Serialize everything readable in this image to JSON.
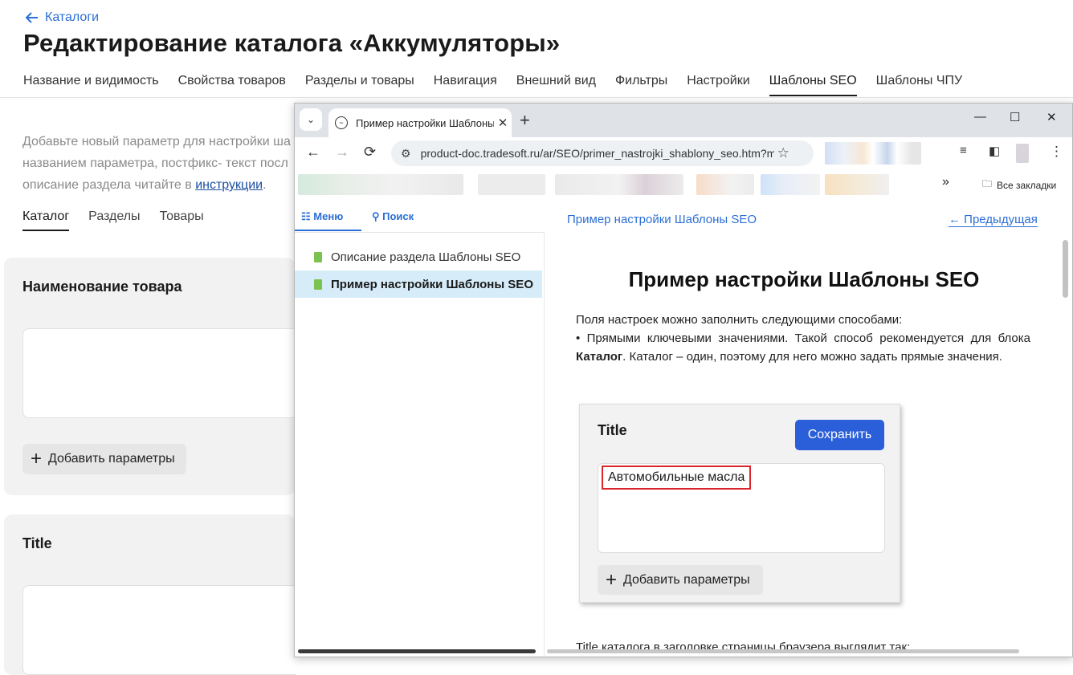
{
  "app": {
    "back_link": "Каталоги",
    "page_title": "Редактирование каталога «Аккумуляторы»",
    "tabs": [
      {
        "label": "Название и видимость",
        "active": false
      },
      {
        "label": "Свойства товаров",
        "active": false
      },
      {
        "label": "Разделы и товары",
        "active": false
      },
      {
        "label": "Навигация",
        "active": false
      },
      {
        "label": "Внешний вид",
        "active": false
      },
      {
        "label": "Фильтры",
        "active": false
      },
      {
        "label": "Настройки",
        "active": false
      },
      {
        "label": "Шаблоны SEO",
        "active": true
      },
      {
        "label": "Шаблоны ЧПУ",
        "active": false
      }
    ],
    "description": {
      "line1": "Добавьте новый параметр для настройки ша",
      "line2": "названием параметра, постфикс- текст посл",
      "line3_prefix": "описание раздела читайте в ",
      "line3_link": "инструкции",
      "line3_suffix": "."
    },
    "subtabs": [
      {
        "label": "Каталог",
        "active": true
      },
      {
        "label": "Разделы",
        "active": false
      },
      {
        "label": "Товары",
        "active": false
      }
    ],
    "card1": {
      "title": "Наименование товара",
      "add_button": "Добавить параметры"
    },
    "card2": {
      "title": "Title"
    }
  },
  "browser": {
    "tab_title": "Пример настройки Шаблоны SEO",
    "url": "product-doc.tradesoft.ru/ar/SEO/primer_nastrojki_shablony_seo.htm?m...",
    "bookmarks_folder": "Все закладки",
    "doc": {
      "sidebar_tabs": {
        "menu": "Меню",
        "search": "Поиск"
      },
      "sidebar_items": [
        {
          "label": "Описание раздела Шаблоны SEO",
          "active": false
        },
        {
          "label": "Пример настройки Шаблоны SEO",
          "active": true
        }
      ],
      "breadcrumb": "Пример настройки Шаблоны SEO",
      "prev_link": "← Предыдущая",
      "heading": "Пример настройки Шаблоны SEO",
      "intro": "Поля настроек можно заполнить следующими способами:",
      "bullet_prefix": "• Прямыми ключевыми значениями. Такой способ рекомендуется для блока ",
      "bullet_bold": "Каталог",
      "bullet_suffix": ". Каталог – один, поэтому для него можно задать прямые значения.",
      "screenshot": {
        "title": "Title",
        "save_button": "Сохранить",
        "field_value": "Автомобильные масла",
        "add_button": "Добавить параметры"
      },
      "tail_text": "Title каталога в заголовке страницы браузера выглядит так:"
    }
  }
}
